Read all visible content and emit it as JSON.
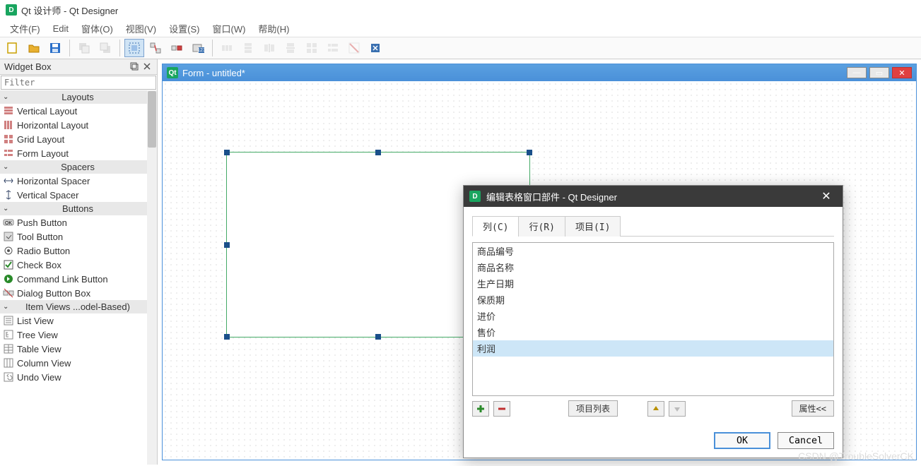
{
  "app": {
    "title": "Qt 设计师 - Qt Designer"
  },
  "menu": [
    "文件(F)",
    "Edit",
    "窗体(O)",
    "视图(V)",
    "设置(S)",
    "窗口(W)",
    "帮助(H)"
  ],
  "widgetBox": {
    "panelTitle": "Widget Box",
    "filterPlaceholder": "Filter",
    "groups": [
      {
        "name": "Layouts",
        "items": [
          "Vertical Layout",
          "Horizontal Layout",
          "Grid Layout",
          "Form Layout"
        ]
      },
      {
        "name": "Spacers",
        "items": [
          "Horizontal Spacer",
          "Vertical Spacer"
        ]
      },
      {
        "name": "Buttons",
        "items": [
          "Push Button",
          "Tool Button",
          "Radio Button",
          "Check Box",
          "Command Link Button",
          "Dialog Button Box"
        ]
      },
      {
        "name": "Item Views ...odel-Based)",
        "items": [
          "List View",
          "Tree View",
          "Table View",
          "Column View",
          "Undo View"
        ]
      }
    ]
  },
  "form": {
    "title": "Form - untitled*"
  },
  "dialog": {
    "title": "编辑表格窗口部件 - Qt Designer",
    "tabs": [
      "列(C)",
      "行(R)",
      "项目(I)"
    ],
    "columns": [
      "商品编号",
      "商品名称",
      "生产日期",
      "保质期",
      "进价",
      "售价",
      "利润"
    ],
    "selectedIndex": 6,
    "itemListLabel": "项目列表",
    "propsLabel": "属性<<",
    "ok": "OK",
    "cancel": "Cancel"
  },
  "watermark": "CSDN @TroubleSolverCK"
}
